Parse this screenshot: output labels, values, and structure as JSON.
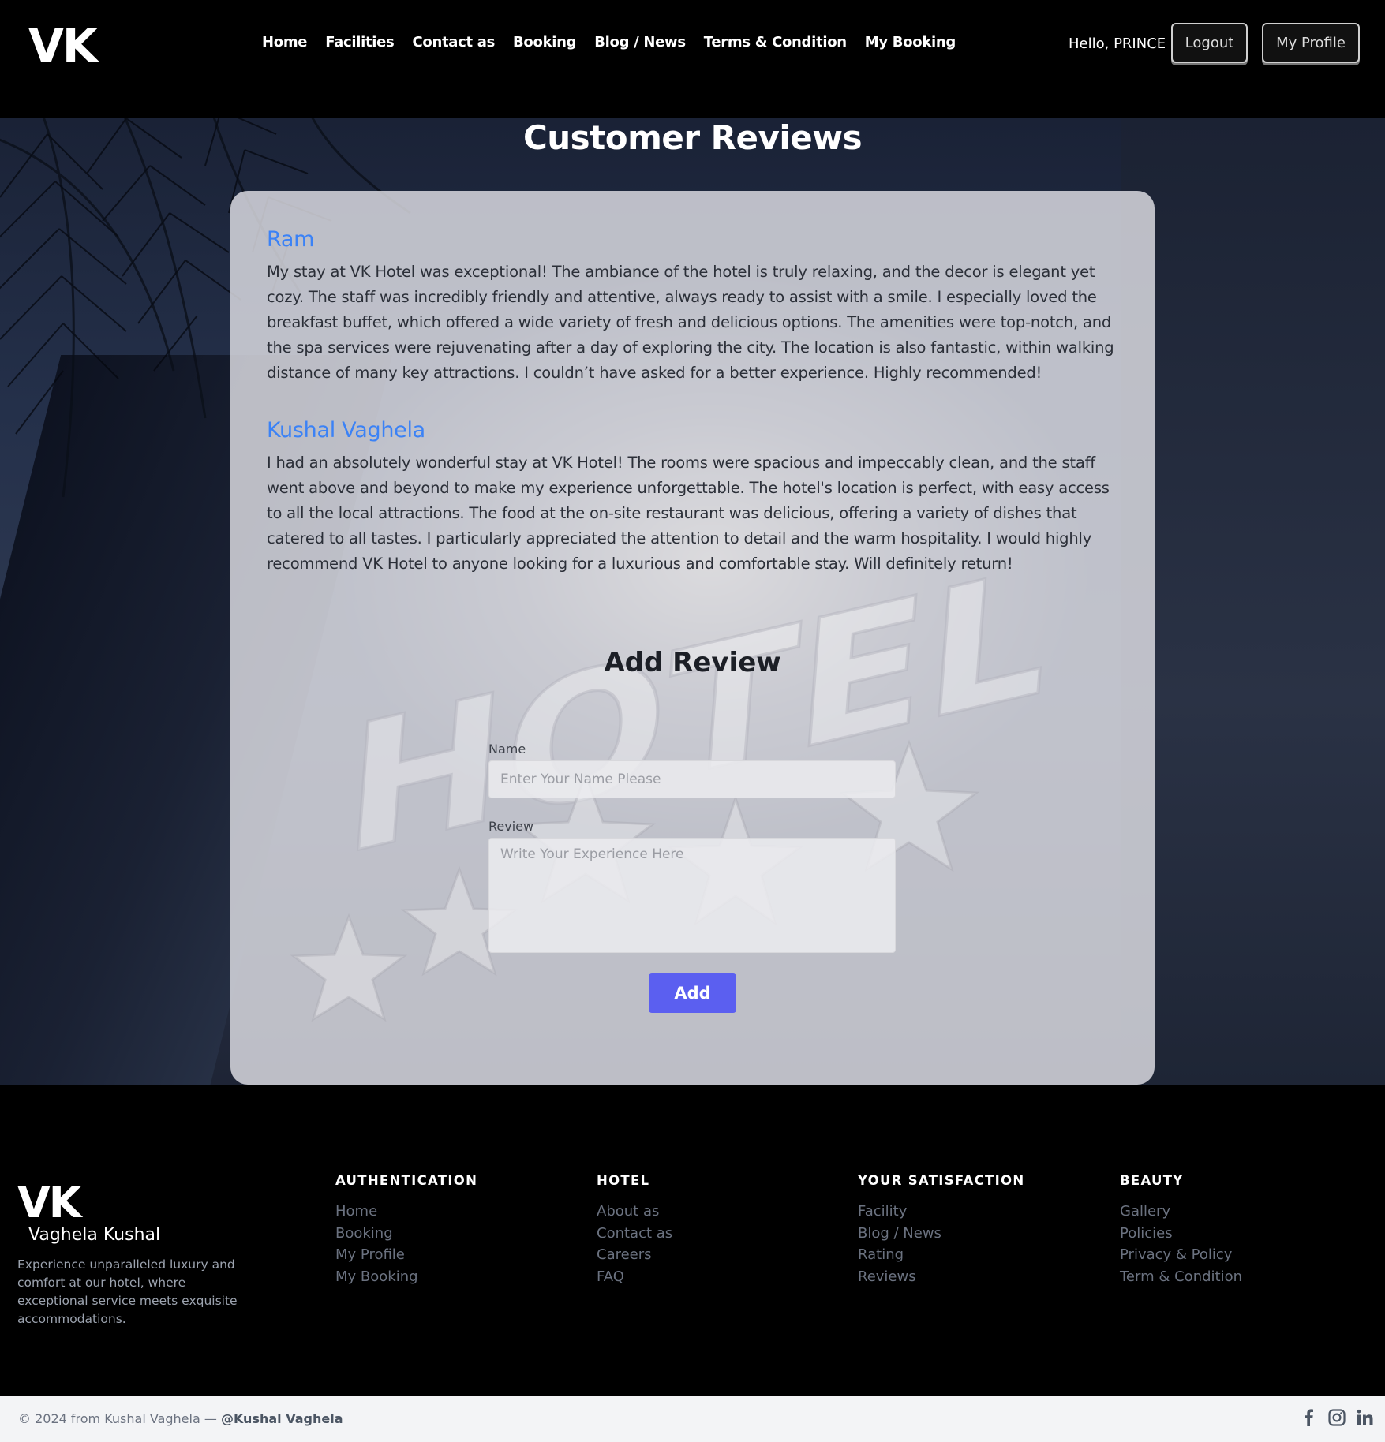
{
  "header": {
    "logo": "VK",
    "nav": [
      "Home",
      "Facilities",
      "Contact as",
      "Booking",
      "Blog / News",
      "Terms & Condition",
      "My Booking"
    ],
    "greeting": "Hello, PRINCE",
    "logout_label": "Logout",
    "profile_label": "My Profile"
  },
  "main": {
    "title": "Customer Reviews",
    "reviews": [
      {
        "name": "Ram",
        "text": "My stay at VK Hotel was exceptional! The ambiance of the hotel is truly relaxing, and the decor is elegant yet cozy. The staff was incredibly friendly and attentive, always ready to assist with a smile. I especially loved the breakfast buffet, which offered a wide variety of fresh and delicious options. The amenities were top-notch, and the spa services were rejuvenating after a day of exploring the city. The location is also fantastic, within walking distance of many key attractions. I couldn’t have asked for a better experience. Highly recommended!"
      },
      {
        "name": "Kushal Vaghela",
        "text": "I had an absolutely wonderful stay at VK Hotel! The rooms were spacious and impeccably clean, and the staff went above and beyond to make my experience unforgettable. The hotel's location is perfect, with easy access to all the local attractions. The food at the on-site restaurant was delicious, offering a variety of dishes that catered to all tastes. I particularly appreciated the attention to detail and the warm hospitality. I would highly recommend VK Hotel to anyone looking for a luxurious and comfortable stay. Will definitely return!"
      }
    ],
    "form": {
      "title": "Add Review",
      "name_label": "Name",
      "name_placeholder": "Enter Your Name Please",
      "review_label": "Review",
      "review_placeholder": "Write Your Experience Here",
      "submit_label": "Add"
    },
    "watermark_text": "HOTEL"
  },
  "footer": {
    "logo": "VK",
    "brand_name": "Vaghela Kushal",
    "description": "Experience unparalleled luxury and comfort at our hotel, where exceptional service meets exquisite accommodations.",
    "columns": [
      {
        "title": "AUTHENTICATION",
        "links": [
          "Home",
          "Booking",
          "My Profile",
          "My Booking"
        ]
      },
      {
        "title": "HOTEL",
        "links": [
          "About as",
          "Contact as",
          "Careers",
          "FAQ"
        ]
      },
      {
        "title": "YOUR SATISFACTION",
        "links": [
          "Facility",
          "Blog / News",
          "Rating",
          "Reviews"
        ]
      },
      {
        "title": "BEAUTY",
        "links": [
          "Gallery",
          "Policies",
          "Privacy & Policy",
          "Term & Condition"
        ]
      }
    ],
    "copyright_prefix": "© 2024 from Kushal Vaghela — ",
    "copyright_handle": "@Kushal Vaghela",
    "socials": [
      "facebook-icon",
      "instagram-icon",
      "linkedin-icon"
    ]
  },
  "colors": {
    "accent_blue": "#3b82f6",
    "button_indigo": "#5b5ff0",
    "header_bg": "#000000",
    "footer_link": "#6b7280"
  }
}
